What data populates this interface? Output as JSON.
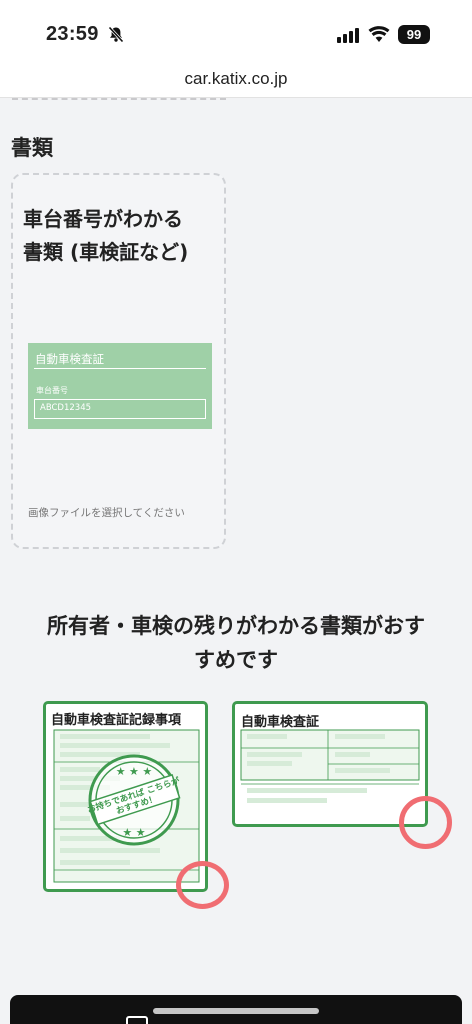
{
  "status_bar": {
    "time": "23:59",
    "battery": "99"
  },
  "browser": {
    "url": "car.katix.co.jp"
  },
  "documents_section": {
    "title": "書類"
  },
  "upload_card": {
    "title_line1": "車台番号がわかる",
    "title_line2": "書類 (車検証など)",
    "sample_cert_title": "自動車検査証",
    "sample_field_label": "車台番号",
    "sample_field_value": "ABCD12345",
    "select_file_text": "画像ファイルを選択してください"
  },
  "recommendation": {
    "line1": "所有者・車検の残りがわかる書類がおす",
    "line2": "すめです",
    "doc1_title": "自動車検査証記録事項",
    "doc1_stamp_arc": "お持ちであれば こちらが",
    "doc1_stamp_inner": "おすすめ！",
    "doc2_title": "自動車検査証"
  },
  "colors": {
    "accent_green": "#3f9a4f",
    "highlight_red": "#f06d72",
    "card_green": "#9fd0a7"
  }
}
